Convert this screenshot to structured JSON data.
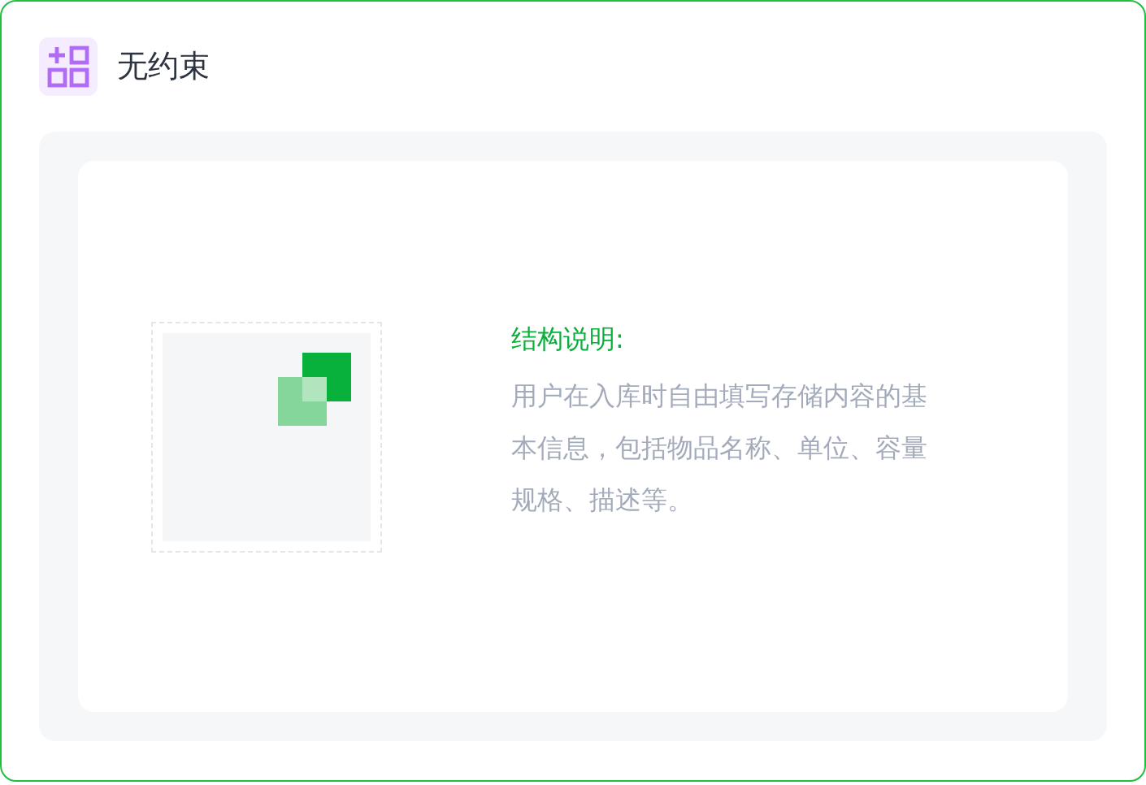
{
  "header": {
    "title": "无约束"
  },
  "description": {
    "heading": "结构说明:",
    "body": "用户在入库时自由填写存储内容的基本信息，包括物品名称、单位、容量规格、描述等。"
  }
}
